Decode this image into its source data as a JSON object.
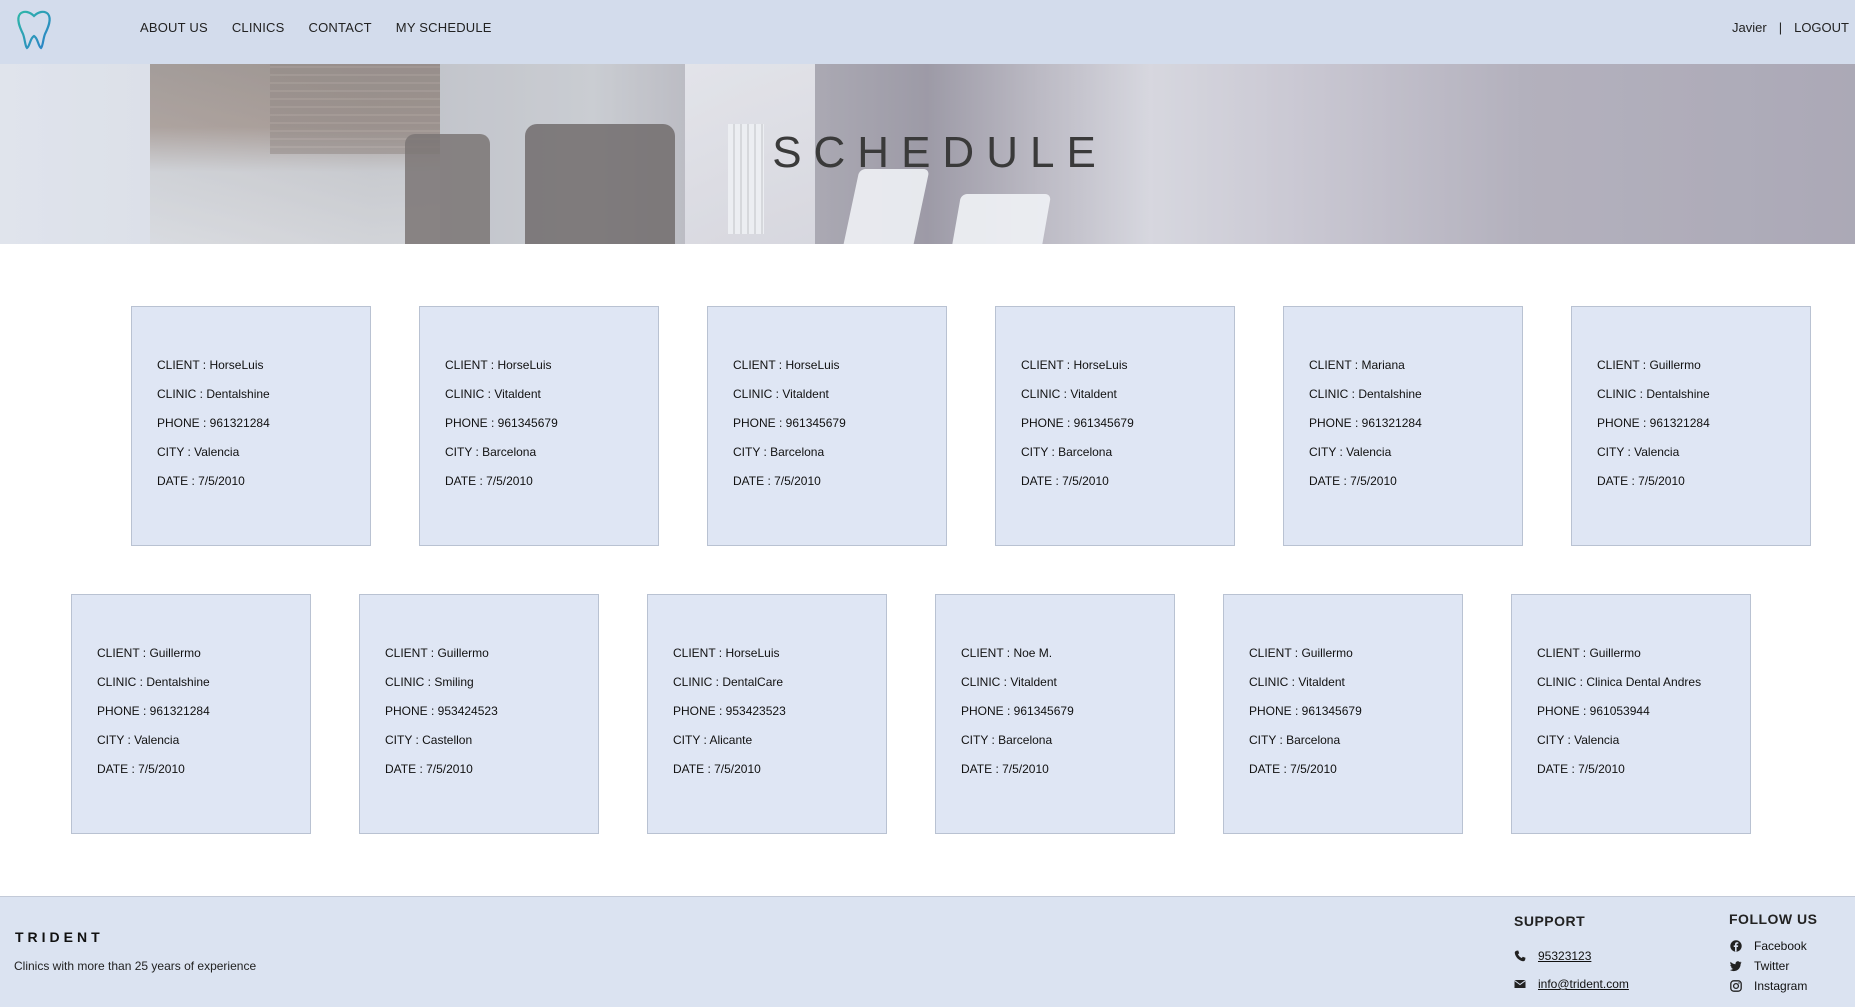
{
  "nav": {
    "items": [
      {
        "label": "ABOUT US"
      },
      {
        "label": "CLINICS"
      },
      {
        "label": "CONTACT"
      },
      {
        "label": "MY SCHEDULE"
      }
    ],
    "user_name": "Javier",
    "separator": "|",
    "logout_label": "LOGOUT"
  },
  "hero": {
    "title": "SCHEDULE"
  },
  "appointments": [
    {
      "client": "CLIENT : HorseLuis",
      "clinic": "CLINIC : Dentalshine",
      "phone": "PHONE : 961321284",
      "city": "CITY : Valencia",
      "date": "DATE : 7/5/2010"
    },
    {
      "client": "CLIENT : HorseLuis",
      "clinic": "CLINIC : Vitaldent",
      "phone": "PHONE : 961345679",
      "city": "CITY : Barcelona",
      "date": "DATE : 7/5/2010"
    },
    {
      "client": "CLIENT : HorseLuis",
      "clinic": "CLINIC : Vitaldent",
      "phone": "PHONE : 961345679",
      "city": "CITY : Barcelona",
      "date": "DATE : 7/5/2010"
    },
    {
      "client": "CLIENT : HorseLuis",
      "clinic": "CLINIC : Vitaldent",
      "phone": "PHONE : 961345679",
      "city": "CITY : Barcelona",
      "date": "DATE : 7/5/2010"
    },
    {
      "client": "CLIENT : Mariana",
      "clinic": "CLINIC : Dentalshine",
      "phone": "PHONE : 961321284",
      "city": "CITY : Valencia",
      "date": "DATE : 7/5/2010"
    },
    {
      "client": "CLIENT : Guillermo",
      "clinic": "CLINIC : Dentalshine",
      "phone": "PHONE : 961321284",
      "city": "CITY : Valencia",
      "date": "DATE : 7/5/2010"
    },
    {
      "client": "CLIENT : Guillermo",
      "clinic": "CLINIC : Dentalshine",
      "phone": "PHONE : 961321284",
      "city": "CITY : Valencia",
      "date": "DATE : 7/5/2010"
    },
    {
      "client": "CLIENT : Guillermo",
      "clinic": "CLINIC : Smiling",
      "phone": "PHONE : 953424523",
      "city": "CITY : Castellon",
      "date": "DATE : 7/5/2010"
    },
    {
      "client": "CLIENT : HorseLuis",
      "clinic": "CLINIC : DentalCare",
      "phone": "PHONE : 953423523",
      "city": "CITY : Alicante",
      "date": "DATE : 7/5/2010"
    },
    {
      "client": "CLIENT : Noe M.",
      "clinic": "CLINIC : Vitaldent",
      "phone": "PHONE : 961345679",
      "city": "CITY : Barcelona",
      "date": "DATE : 7/5/2010"
    },
    {
      "client": "CLIENT : Guillermo",
      "clinic": "CLINIC : Vitaldent",
      "phone": "PHONE : 961345679",
      "city": "CITY : Barcelona",
      "date": "DATE : 7/5/2010"
    },
    {
      "client": "CLIENT : Guillermo",
      "clinic": "CLINIC : Clinica Dental Andres",
      "phone": "PHONE : 961053944",
      "city": "CITY : Valencia",
      "date": "DATE : 7/5/2010"
    }
  ],
  "footer": {
    "brand": "TRIDENT",
    "tagline": "Clinics with more than 25 years of experience",
    "support_title": "SUPPORT",
    "phone": "95323123",
    "email": "info@trident.com",
    "follow_title": "FOLLOW US",
    "social": [
      {
        "label": "Facebook",
        "icon": "facebook-icon"
      },
      {
        "label": "Twitter",
        "icon": "twitter-icon"
      },
      {
        "label": "Instagram",
        "icon": "instagram-icon"
      }
    ]
  },
  "colors": {
    "header_bg": "#d3dcec",
    "card_bg": "#dfe6f4",
    "card_border": "#b9c2d2",
    "footer_bg": "#dbe3f1"
  }
}
